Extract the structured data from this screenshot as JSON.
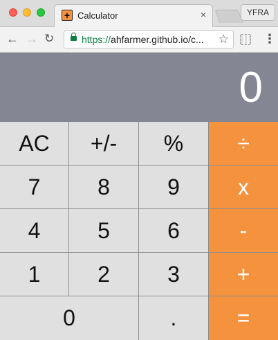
{
  "browser": {
    "tab_title": "Calculator",
    "tab_close": "×",
    "favicon_glyph": "+",
    "profile_label": "YFRA",
    "url_scheme": "https://",
    "url_rest": "ahfarmer.github.io/c...",
    "back_icon": "←",
    "forward_icon": "→",
    "reload_icon": "↻",
    "star_icon": "☆",
    "menu_icon": "⋮"
  },
  "calculator": {
    "display": "0",
    "rows": [
      [
        "AC",
        "+/-",
        "%",
        "÷"
      ],
      [
        "7",
        "8",
        "9",
        "x"
      ],
      [
        "4",
        "5",
        "6",
        "-"
      ],
      [
        "1",
        "2",
        "3",
        "+"
      ],
      [
        "0",
        ".",
        "="
      ]
    ],
    "colors": {
      "display_bg": "#858694",
      "key_bg": "#e0e0e0",
      "operator_bg": "#f5923e"
    }
  }
}
